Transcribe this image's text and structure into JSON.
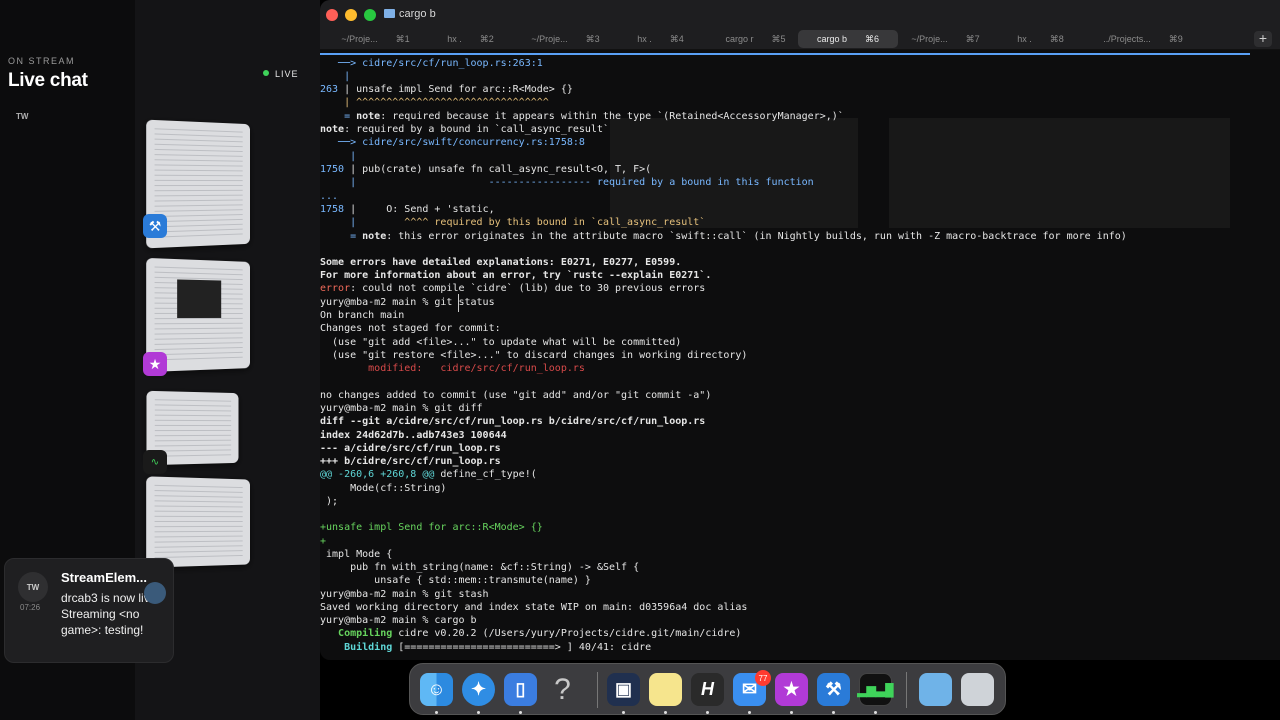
{
  "chat": {
    "on_stream": "ON STREAM",
    "title": "Live chat",
    "live": "LIVE",
    "tw_label": "TW"
  },
  "notification": {
    "avatar": "TW",
    "time": "07:26",
    "title": "StreamElem...",
    "body": "drcab3 is now live! Streaming <no game>: testing!"
  },
  "window": {
    "title": "cargo b"
  },
  "tabs": [
    {
      "label": "~/Proje...",
      "key": "⌘1"
    },
    {
      "label": "hx .",
      "key": "⌘2"
    },
    {
      "label": "~/Proje...",
      "key": "⌘3"
    },
    {
      "label": "hx .",
      "key": "⌘4"
    },
    {
      "label": "cargo r",
      "key": "⌘5"
    },
    {
      "label": "cargo b",
      "key": "⌘6"
    },
    {
      "label": "~/Proje...",
      "key": "⌘7"
    },
    {
      "label": "hx .",
      "key": "⌘8"
    },
    {
      "label": "../Projects...",
      "key": "⌘9"
    }
  ],
  "tab_plus": "+",
  "terminal": {
    "l01": "   ──> cidre/src/cf/run_loop.rs:263:1",
    "l02": "    |",
    "l03n": "263",
    "l03": " | unsafe impl Send for arc::R<Mode> {}",
    "l04": "    | ^^^^^^^^^^^^^^^^^^^^^^^^^^^^^^^^",
    "l05a": "    = ",
    "l05b": "note",
    "l05c": ": required because it appears within the type `(Retained<AccessoryManager>,)`",
    "l06a": "note",
    "l06b": ": required by a bound in `call_async_result`",
    "l07": "   ──> cidre/src/swift/concurrency.rs:1758:8",
    "l08": "     |",
    "l09n": "1750",
    "l09": " | pub(crate) unsafe fn call_async_result<O, T, F>(",
    "l10a": "     |                      ",
    "l10b": "----------------- required by a bound in this function",
    "l11": "...",
    "l12n": "1758",
    "l12": " |     O: Send + 'static,",
    "l13a": "     |        ",
    "l13b": "^^^^ required by this bound in `call_async_result`",
    "l14a": "     = ",
    "l14b": "note",
    "l14c": ": this error originates in the attribute macro `swift::call` (in Nightly builds, run with -Z macro-backtrace for more info)",
    "l15": "Some errors have detailed explanations: E0271, E0277, E0599.",
    "l16": "For more information about an error, try `rustc --explain E0271`.",
    "l17a": "error",
    "l17b": ": could not compile `cidre` (lib) due to 30 previous errors",
    "l18": "yury@mba-m2 main % git status",
    "l19": "On branch main",
    "l20": "Changes not staged for commit:",
    "l21": "  (use \"git add <file>...\" to update what will be committed)",
    "l22": "  (use \"git restore <file>...\" to discard changes in working directory)",
    "l23": "        modified:   cidre/src/cf/run_loop.rs",
    "l24": "no changes added to commit (use \"git add\" and/or \"git commit -a\")",
    "l25": "yury@mba-m2 main % git diff",
    "l26": "diff --git a/cidre/src/cf/run_loop.rs b/cidre/src/cf/run_loop.rs",
    "l27": "index 24d62d7b..adb743e3 100644",
    "l28": "--- a/cidre/src/cf/run_loop.rs",
    "l29": "+++ b/cidre/src/cf/run_loop.rs",
    "l30a": "@@ -260,6 +260,8 @@",
    "l30b": " define_cf_type!(",
    "l31": "     Mode(cf::String)",
    "l32": " );",
    "l33": "+unsafe impl Send for arc::R<Mode> {}",
    "l34": "+",
    "l35": " impl Mode {",
    "l36": "     pub fn with_string(name: &cf::String) -> &Self {",
    "l37": "         unsafe { std::mem::transmute(name) }",
    "l38": "yury@mba-m2 main % git stash",
    "l39": "Saved working directory and index state WIP on main: d03596a4 doc alias",
    "l40": "yury@mba-m2 main % cargo b",
    "l41a": "   Compiling",
    "l41b": " cidre v0.20.2 (/Users/yury/Projects/cidre.git/main/cidre)",
    "l42a": "    Building",
    "l42b": " [=========================> ] 40/41: cidre"
  },
  "dock": {
    "items": [
      "finder-icon",
      "safari-icon",
      "simulator-icon",
      "help-icon",
      "preview-icon",
      "notes-icon",
      "helix-icon",
      "mail-icon",
      "superstar-icon",
      "xcode-icon",
      "activity-monitor-icon",
      "downloads-folder-icon",
      "trash-icon"
    ],
    "help_glyph": "?",
    "helix_glyph": "H",
    "superstar_glyph": "★",
    "mail_badge": "77"
  },
  "colors": {
    "accent": "#5aa0f5",
    "error": "#f06a5a",
    "diff_added": "#67d45e",
    "diff_hunk": "#5fd7d7"
  }
}
